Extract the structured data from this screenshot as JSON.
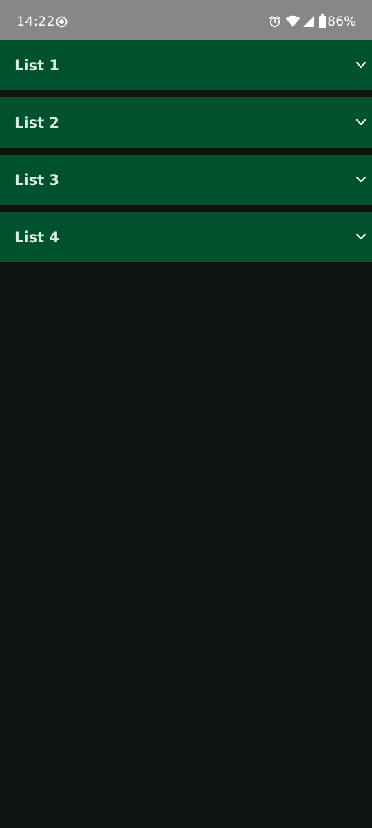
{
  "status_bar": {
    "time": "14:22",
    "battery": "86%",
    "icons": [
      "screen-record-icon",
      "alarm-icon",
      "wifi-icon",
      "cell-signal-icon",
      "battery-icon"
    ]
  },
  "lists": [
    {
      "label": "List 1",
      "icon": "chevron-down-icon"
    },
    {
      "label": "List 2",
      "icon": "chevron-down-icon"
    },
    {
      "label": "List 3",
      "icon": "chevron-down-icon"
    },
    {
      "label": "List 4",
      "icon": "chevron-down-icon"
    }
  ],
  "colors": {
    "status_bar_bg": "#858886",
    "row_bg": "#00522d",
    "page_bg": "#101512",
    "row_text": "#dbece2"
  }
}
